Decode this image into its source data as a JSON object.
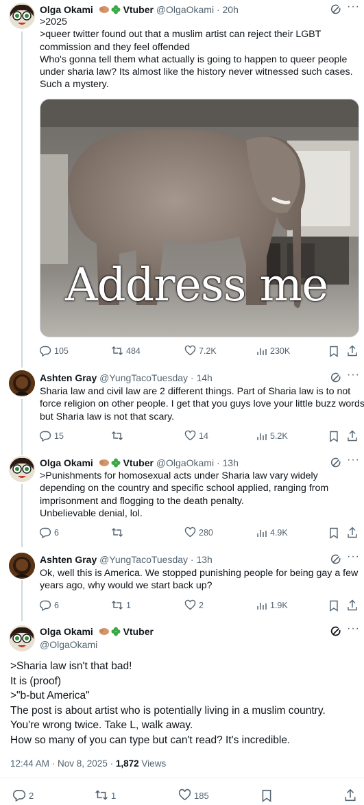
{
  "tweets": [
    {
      "name": "Olga Okami",
      "badge_text": "Vtuber",
      "handle": "@OlgaOkami",
      "time": "· 20h",
      "lines": [
        ">2025",
        ">queer twitter found out that a muslim artist can reject their LGBT",
        "commission and they feel offended",
        "Who's gonna tell them what actually is going to happen to queer people",
        "under sharia law? Its almost like the history never witnessed such cases.",
        "Such a mystery."
      ],
      "image_caption": "Address me",
      "replies": "105",
      "retweets": "484",
      "likes": "7.2K",
      "views": "230K"
    },
    {
      "name": "Ashten Gray",
      "handle": "@YungTacoTuesday",
      "time": "· 14h",
      "lines": [
        "Sharia law and civil law are 2 different things. Part of Sharia law is to not",
        "force religion on other people. I get that you guys love your little buzz words,",
        "but Sharia law is not that scary."
      ],
      "replies": "15",
      "retweets": "",
      "likes": "14",
      "views": "5.2K"
    },
    {
      "name": "Olga Okami",
      "badge_text": "Vtuber",
      "handle": "@OlgaOkami",
      "time": "· 13h",
      "lines": [
        ">Punishments for homosexual acts under Sharia law vary widely",
        "depending on the country and specific school applied, ranging from",
        "imprisonment and flogging to the death penalty.",
        "Unbelievable denial, lol."
      ],
      "replies": "6",
      "retweets": "",
      "likes": "280",
      "views": "4.9K"
    },
    {
      "name": "Ashten Gray",
      "handle": "@YungTacoTuesday",
      "time": "· 13h",
      "lines": [
        "Ok, well this is America. We stopped punishing people for being gay a few",
        "years ago, why would we start back up?"
      ],
      "replies": "6",
      "retweets": "1",
      "likes": "2",
      "views": "1.9K"
    }
  ],
  "main": {
    "name": "Olga Okami",
    "badge_text": "Vtuber",
    "handle": "@OlgaOkami",
    "lines": [
      ">Sharia law isn't that bad!",
      "It is (proof)",
      ">\"b-but America\"",
      "The post is about artist who is potentially living in a muslim country.",
      "You're wrong twice. Take L, walk away.",
      "How so many of you can type but can't read? It's incredible."
    ],
    "timestamp": "12:44 AM · Nov 8, 2025 ·",
    "views_count": "1,872",
    "views_label": "Views",
    "replies": "2",
    "retweets": "1",
    "likes": "185"
  },
  "icons": {
    "more": "more-icon",
    "grok": "grok-icon",
    "reply": "reply-icon",
    "retweet": "retweet-icon",
    "like": "heart-icon",
    "views": "views-icon",
    "bookmark": "bookmark-icon",
    "share": "share-icon"
  },
  "colors": {
    "text": "#0f1419",
    "secondary": "#536471",
    "thread_line": "#cfd9de"
  }
}
